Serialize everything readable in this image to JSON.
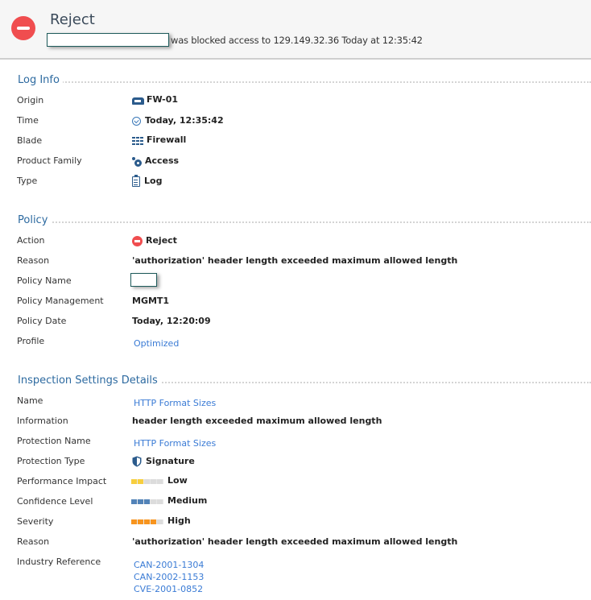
{
  "header": {
    "icon": "reject-icon",
    "title": "Reject",
    "message": "was blocked access to 129.149.32.36 Today at  12:35:42"
  },
  "sections": {
    "log_info": {
      "title": "Log Info",
      "rows": [
        {
          "label": "Origin",
          "value": "FW-01",
          "icon": "gateway-device-icon"
        },
        {
          "label": "Time",
          "value": "Today, 12:35:42",
          "icon": "clock-icon"
        },
        {
          "label": "Blade",
          "value": "Firewall",
          "icon": "firewall-blade-icon"
        },
        {
          "label": "Product Family",
          "value": "Access",
          "icon": "access-icon"
        },
        {
          "label": "Type",
          "value": "Log",
          "icon": "log-icon"
        }
      ]
    },
    "policy": {
      "title": "Policy",
      "rows": [
        {
          "label": "Action",
          "value": "Reject",
          "icon": "reject-icon"
        },
        {
          "label": "Reason",
          "value": "'authorization' header length exceeded maximum allowed length"
        },
        {
          "label": "Policy Name",
          "value": ""
        },
        {
          "label": "Policy Management",
          "value": "MGMT1"
        },
        {
          "label": "Policy Date",
          "value": "Today, 12:20:09"
        },
        {
          "label": "Profile",
          "value": "Optimized",
          "link": true
        }
      ]
    },
    "inspection": {
      "title": "Inspection Settings Details",
      "rows": [
        {
          "label": "Name",
          "value": "HTTP Format Sizes",
          "link": true
        },
        {
          "label": "Information",
          "value": "header length exceeded maximum allowed length"
        },
        {
          "label": "Protection Name",
          "value": "HTTP Format Sizes",
          "link": true
        },
        {
          "label": "Protection Type",
          "value": "Signature",
          "icon": "shield-icon"
        },
        {
          "label": "Performance Impact",
          "value": "Low",
          "level": 2,
          "level_max": 5,
          "color": "#f7ce3e"
        },
        {
          "label": "Confidence Level",
          "value": "Medium",
          "level": 3,
          "level_max": 5,
          "color": "#5283b8"
        },
        {
          "label": "Severity",
          "value": "High",
          "level": 4,
          "level_max": 5,
          "color": "#f7941e"
        },
        {
          "label": "Reason",
          "value": "'authorization' header length exceeded maximum allowed length"
        },
        {
          "label": "Industry Reference",
          "refs": [
            "CAN-2001-1304",
            "CAN-2002-1153",
            "CVE-2001-0852"
          ]
        }
      ]
    }
  }
}
